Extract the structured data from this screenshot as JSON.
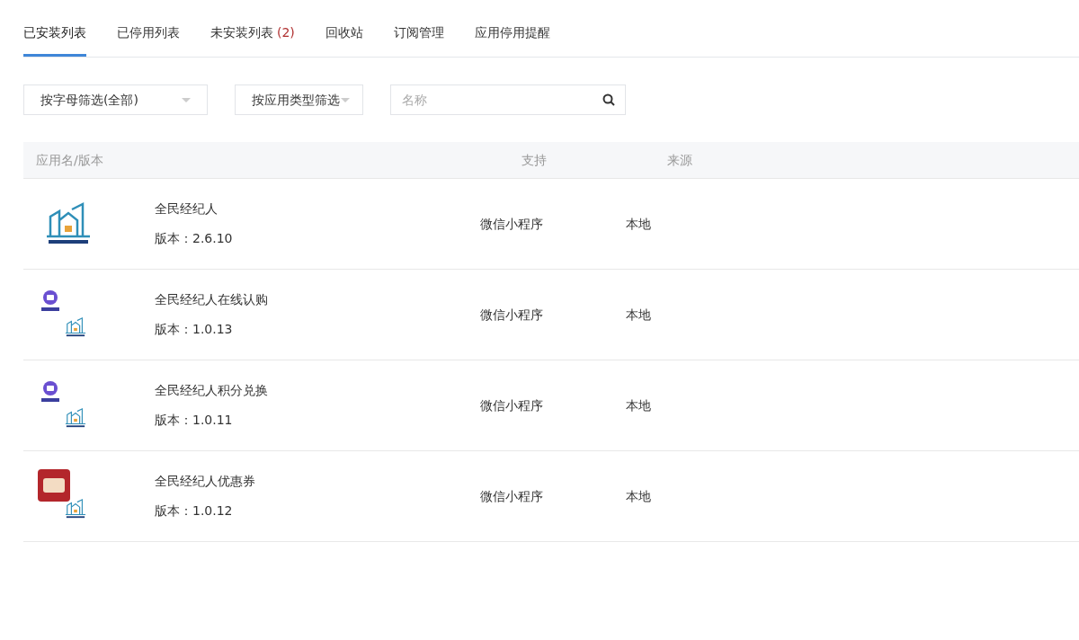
{
  "tabs": [
    {
      "label": "已安装列表",
      "selected": true
    },
    {
      "label": "已停用列表",
      "selected": false
    },
    {
      "label": "未安装列表",
      "count": "(2)",
      "selected": false
    },
    {
      "label": "回收站",
      "selected": false
    },
    {
      "label": "订阅管理",
      "selected": false
    },
    {
      "label": "应用停用提醒",
      "selected": false
    }
  ],
  "filters": {
    "letter": "按字母筛选(全部)",
    "type": "按应用类型筛选",
    "search_placeholder": "名称"
  },
  "table": {
    "columns": [
      "应用名/版本",
      "支持",
      "来源"
    ],
    "rows": [
      {
        "kind": "building",
        "name": "全民经纪人",
        "version": "版本：2.6.10",
        "support": "微信小程序",
        "source": "本地"
      },
      {
        "kind": "purchase",
        "name": "全民经纪人在线认购",
        "version": "版本：1.0.13",
        "support": "微信小程序",
        "source": "本地"
      },
      {
        "kind": "purchase",
        "name": "全民经纪人积分兑换",
        "version": "版本：1.0.11",
        "support": "微信小程序",
        "source": "本地"
      },
      {
        "kind": "coupon",
        "name": "全民经纪人优惠券",
        "version": "版本：1.0.12",
        "support": "微信小程序",
        "source": "本地"
      }
    ]
  }
}
